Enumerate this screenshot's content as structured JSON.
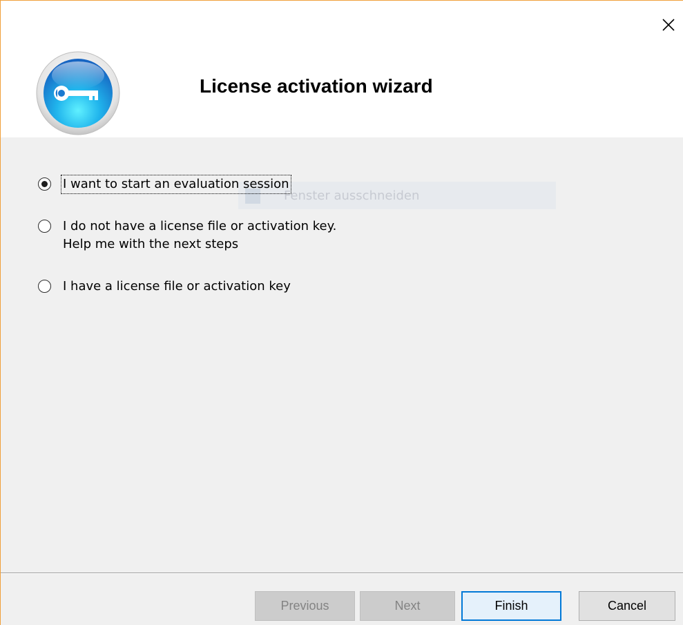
{
  "window": {
    "title": "License activation wizard",
    "close_icon": "close-icon",
    "accent_color": "#f0a03a"
  },
  "logo": {
    "icon": "key-icon",
    "colors": {
      "outer": "#dcdcdc",
      "inner": "#1e7fd0",
      "highlight": "#4fe0f5"
    }
  },
  "background_overlay": {
    "text": "Fenster ausschneiden"
  },
  "options": [
    {
      "label_lines": [
        "I want to start an evaluation session"
      ],
      "selected": true,
      "focused": true
    },
    {
      "label_lines": [
        "I do not have a license file or activation key.",
        "Help me with the next steps"
      ],
      "selected": false,
      "focused": false
    },
    {
      "label_lines": [
        "I have a license file or activation key"
      ],
      "selected": false,
      "focused": false
    }
  ],
  "buttons": {
    "previous": {
      "label": "Previous",
      "enabled": false
    },
    "next": {
      "label": "Next",
      "enabled": false
    },
    "finish": {
      "label": "Finish",
      "enabled": true,
      "default": true
    },
    "cancel": {
      "label": "Cancel",
      "enabled": true
    }
  }
}
